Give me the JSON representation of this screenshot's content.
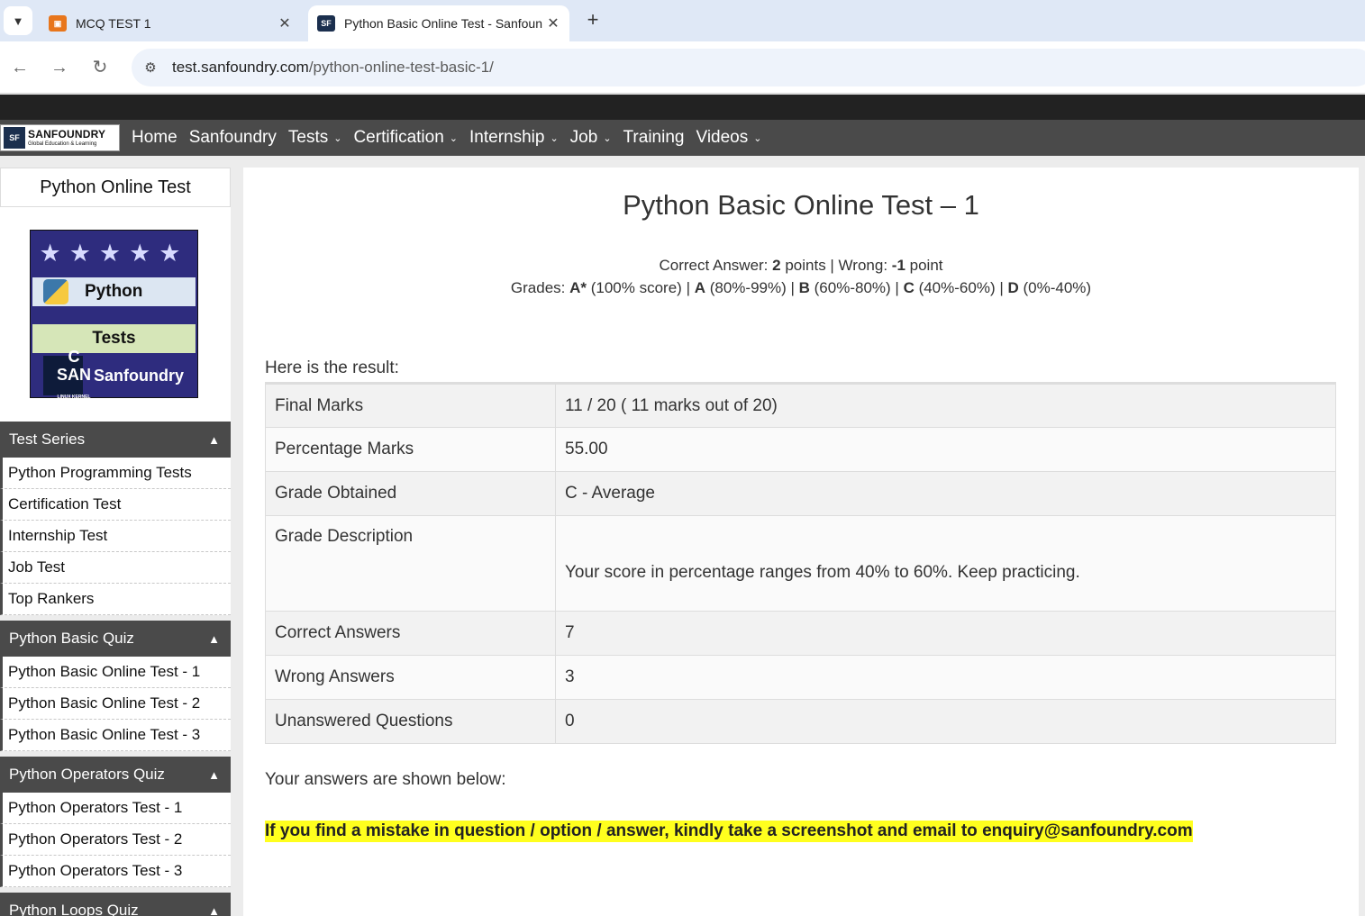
{
  "browser": {
    "tabs": [
      {
        "title": "MCQ TEST 1",
        "icon": "form-icon"
      },
      {
        "title": "Python Basic Online Test - Sanfoundry",
        "icon": "sanfoundry-icon"
      }
    ],
    "tab_close": "✕",
    "new_tab": "+",
    "url_host": "test.sanfoundry.com",
    "url_path": "/python-online-test-basic-1/"
  },
  "site": {
    "logo_name": "SANFOUNDRY",
    "logo_tag": "Global Education & Learning",
    "logo_mark": "SF",
    "nav": [
      "Home",
      "Sanfoundry",
      "Tests",
      "Certification",
      "Internship",
      "Job",
      "Training",
      "Videos"
    ],
    "nav_dropdown": [
      false,
      false,
      true,
      true,
      true,
      true,
      false,
      true
    ]
  },
  "sidebar": {
    "title": "Python Online Test",
    "banner": {
      "stars": "★★★★★",
      "language": "Python",
      "tests": "Tests",
      "brand": "Sanfoundry",
      "brand_img_line1": "C",
      "brand_img_line2": "SAN",
      "brand_img_line3": "LINUX KERNEL"
    },
    "sections": [
      {
        "title": "Test Series",
        "links": [
          "Python Programming Tests",
          "Certification Test",
          "Internship Test",
          "Job Test",
          "Top Rankers"
        ]
      },
      {
        "title": "Python Basic Quiz",
        "links": [
          "Python Basic Online Test - 1",
          "Python Basic Online Test - 2",
          "Python Basic Online Test - 3"
        ]
      },
      {
        "title": "Python Operators Quiz",
        "links": [
          "Python Operators Test - 1",
          "Python Operators Test - 2",
          "Python Operators Test - 3"
        ]
      },
      {
        "title": "Python Loops Quiz",
        "links": []
      }
    ]
  },
  "main": {
    "title": "Python Basic Online Test – 1",
    "scoring": {
      "correct_label": "Correct Answer: ",
      "correct_value": "2",
      "correct_unit": " points | Wrong: ",
      "wrong_value": "-1",
      "wrong_unit": " point",
      "grades_label": "Grades: ",
      "grades": [
        {
          "grade": "A*",
          "range": " (100% score)"
        },
        {
          "grade": "A",
          "range": " (80%-99%)"
        },
        {
          "grade": "B",
          "range": " (60%-80%)"
        },
        {
          "grade": "C",
          "range": " (40%-60%)"
        },
        {
          "grade": "D",
          "range": " (0%-40%)"
        }
      ]
    },
    "result_label": "Here is the result:",
    "result_rows": [
      {
        "key": "Final Marks",
        "value": "11 / 20 ( 11 marks out of 20)"
      },
      {
        "key": "Percentage Marks",
        "value": "55.00"
      },
      {
        "key": "Grade Obtained",
        "value": "C - Average"
      },
      {
        "key": "Grade Description",
        "value": "Your score in percentage ranges from 40% to 60%. Keep practicing."
      },
      {
        "key": "Correct Answers",
        "value": "7"
      },
      {
        "key": "Wrong Answers",
        "value": "3"
      },
      {
        "key": "Unanswered Questions",
        "value": "0"
      }
    ],
    "answers_label": "Your answers are shown below:",
    "notice": "If you find a mistake in question / option / answer, kindly take a screenshot and email to enquiry@sanfoundry.com",
    "notice_color": "#ffff1e"
  }
}
